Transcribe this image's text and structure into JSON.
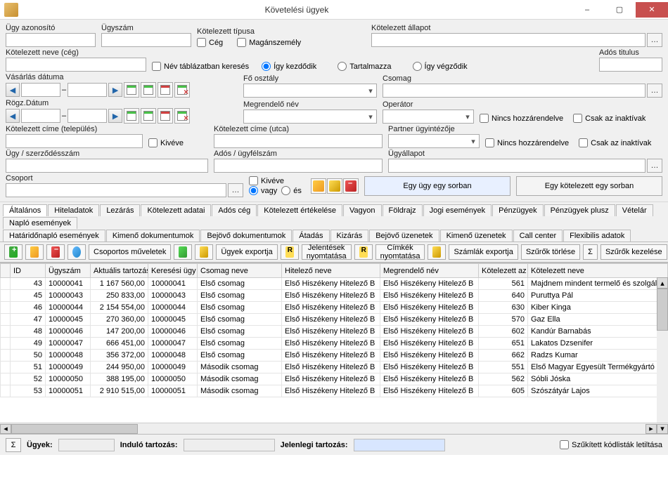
{
  "window": {
    "title": "Követelési ügyek"
  },
  "filters": {
    "ugy_azonosito": "Ügy azonosító",
    "ugyszam": "Ügyszám",
    "kotelezett_tipusa": "Kötelezett típusa",
    "ceg": "Cég",
    "maganszemely": "Magánszemély",
    "kotelezett_allapot": "Kötelezett állapot",
    "kotelezett_neve_ceg": "Kötelezett neve (cég)",
    "nev_tablazatban": "Név táblázatban keresés",
    "igy_kezdodik": "Így kezdődik",
    "tartalmazza": "Tartalmazza",
    "igy_vegzodik": "Így végződik",
    "ados_titulus": "Adós titulus",
    "vasarlas_datuma": "Vásárlás dátuma",
    "fo_osztaly": "Fő osztály",
    "csomag": "Csomag",
    "rogz_datum": "Rögz.Dátum",
    "megrendelo_nev": "Megrendelő név",
    "operator": "Operátor",
    "nincs_hozzarendelve": "Nincs hozzárendelve",
    "csak_inaktivak": "Csak az inaktívak",
    "kotelezett_cime_telepules": "Kötelezett címe (település)",
    "kiveve": "Kivéve",
    "kotelezett_cime_utca": "Kötelezett címe (utca)",
    "partner_ugyintezo": "Partner ügyintézője",
    "ugy_szerzodeszam": "Ügy / szerződésszám",
    "ados_ugyfelszam": "Adós / ügyfélszám",
    "ugyallapot": "Ügyállapot",
    "csoport": "Csoport",
    "vagy": "vagy",
    "es": "és",
    "egy_ugy_sorban": "Egy ügy egy sorban",
    "egy_kotelezett_sorban": "Egy kötelezett egy sorban"
  },
  "tabs_row1": [
    "Általános",
    "Hiteladatok",
    "Lezárás",
    "Kötelezett adatai",
    "Adós cég",
    "Kötelezett értékelése",
    "Vagyon",
    "Földrajz",
    "Jogi események",
    "Pénzügyek",
    "Pénzügyek plusz",
    "Vételár",
    "Napló események"
  ],
  "tabs_row2": [
    "Határidőnapló események",
    "Kimenő dokumentumok",
    "Bejövő dokumentumok",
    "Átadás",
    "Kizárás",
    "Bejövő üzenetek",
    "Kimenő üzenetek",
    "Call center",
    "Flexibilis adatok"
  ],
  "toolbar": {
    "csoportos": "Csoportos műveletek",
    "ugyek_export": "Ügyek exportja",
    "jelentesek": "Jelentések\nnyomtatása",
    "cimkek": "Címkék\nnyomtatása",
    "szamlak": "Számlák exportja",
    "szurok_torlese": "Szűrők törlése",
    "szurok_kezelese": "Szűrők kezelése"
  },
  "grid": {
    "headers": [
      "ID",
      "Ügyszám",
      "Aktuális tartozás",
      "Keresési ügy",
      "Csomag neve",
      "Hitelező neve",
      "Megrendelő név",
      "Kötelezett az",
      "Kötelezett neve"
    ],
    "rows": [
      {
        "id": 43,
        "ugyszam": "10000041",
        "tartozas": "1 167 560,00",
        "keresesi": "10000041",
        "csomag": "Első csomag",
        "hitelezo": "Első Hiszékeny Hitelező B",
        "megrendelo": "Első Hiszékeny Hitelező B",
        "azon": 561,
        "nev": "Majdnem mindent termelő és szolgáltat"
      },
      {
        "id": 45,
        "ugyszam": "10000043",
        "tartozas": "250 833,00",
        "keresesi": "10000043",
        "csomag": "Első csomag",
        "hitelezo": "Első Hiszékeny Hitelező B",
        "megrendelo": "Első Hiszékeny Hitelező B",
        "azon": 640,
        "nev": "Puruttya Pál"
      },
      {
        "id": 46,
        "ugyszam": "10000044",
        "tartozas": "2 154 554,00",
        "keresesi": "10000044",
        "csomag": "Első csomag",
        "hitelezo": "Első Hiszékeny Hitelező B",
        "megrendelo": "Első Hiszékeny Hitelező B",
        "azon": 630,
        "nev": "Kiber Kinga"
      },
      {
        "id": 47,
        "ugyszam": "10000045",
        "tartozas": "270 360,00",
        "keresesi": "10000045",
        "csomag": "Első csomag",
        "hitelezo": "Első Hiszékeny Hitelező B",
        "megrendelo": "Első Hiszékeny Hitelező B",
        "azon": 570,
        "nev": "Gaz Ella"
      },
      {
        "id": 48,
        "ugyszam": "10000046",
        "tartozas": "147 200,00",
        "keresesi": "10000046",
        "csomag": "Első csomag",
        "hitelezo": "Első Hiszékeny Hitelező B",
        "megrendelo": "Első Hiszékeny Hitelező B",
        "azon": 602,
        "nev": "Kandúr Barnabás"
      },
      {
        "id": 49,
        "ugyszam": "10000047",
        "tartozas": "666 451,00",
        "keresesi": "10000047",
        "csomag": "Első csomag",
        "hitelezo": "Első Hiszékeny Hitelező B",
        "megrendelo": "Első Hiszékeny Hitelező B",
        "azon": 651,
        "nev": "Lakatos Dzsenifer"
      },
      {
        "id": 50,
        "ugyszam": "10000048",
        "tartozas": "356 372,00",
        "keresesi": "10000048",
        "csomag": "Első csomag",
        "hitelezo": "Első Hiszékeny Hitelező B",
        "megrendelo": "Első Hiszékeny Hitelező B",
        "azon": 662,
        "nev": "Radzs Kumar"
      },
      {
        "id": 51,
        "ugyszam": "10000049",
        "tartozas": "244 950,00",
        "keresesi": "10000049",
        "csomag": "Második csomag",
        "hitelezo": "Első Hiszékeny Hitelező B",
        "megrendelo": "Első Hiszékeny Hitelező B",
        "azon": 551,
        "nev": "Első Magyar Egyesült Termékgyártó Kf"
      },
      {
        "id": 52,
        "ugyszam": "10000050",
        "tartozas": "388 195,00",
        "keresesi": "10000050",
        "csomag": "Második csomag",
        "hitelezo": "Első Hiszékeny Hitelező B",
        "megrendelo": "Első Hiszékeny Hitelező B",
        "azon": 562,
        "nev": "Sóbli Jóska"
      },
      {
        "id": 53,
        "ugyszam": "10000051",
        "tartozas": "2 910 515,00",
        "keresesi": "10000051",
        "csomag": "Második csomag",
        "hitelezo": "Első Hiszékeny Hitelező B",
        "megrendelo": "Első Hiszékeny Hitelező B",
        "azon": 605,
        "nev": "Szószátyár Lajos"
      }
    ]
  },
  "status": {
    "ugyek": "Ügyek:",
    "indulo": "Induló tartozás:",
    "jelenlegi": "Jelenlegi tartozás:",
    "szukitett": "Szűkített kódlisták letiltása"
  }
}
